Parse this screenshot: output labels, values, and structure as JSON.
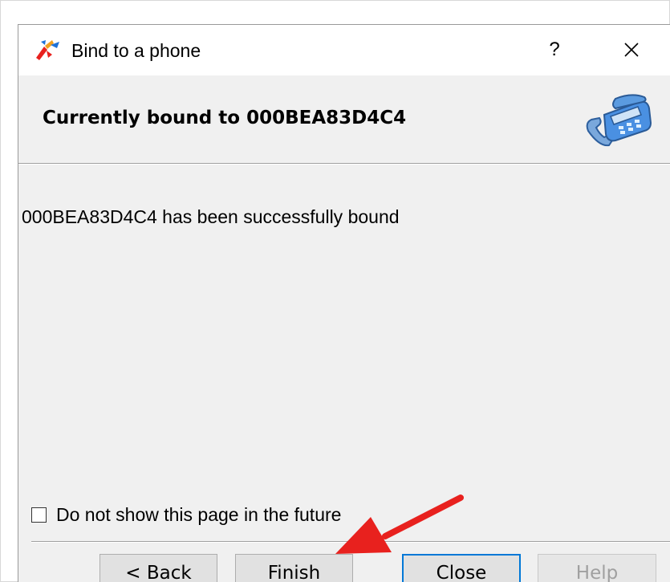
{
  "window": {
    "title": "Bind to a phone",
    "help_label": "?",
    "close_icon": "close-icon"
  },
  "header": {
    "title": "Currently bound to 000BEA83D4C4",
    "icon": "telephone-icon"
  },
  "body": {
    "message": "000BEA83D4C4 has been successfully bound"
  },
  "options": {
    "dont_show_label": "Do not show this page in the future",
    "dont_show_checked": false
  },
  "buttons": {
    "back": "< Back",
    "finish": "Finish",
    "close": "Close",
    "help": "Help"
  },
  "annotation": {
    "arrow_color": "#e8211e"
  },
  "colors": {
    "accent": "#0078d7",
    "dialog_bg": "#f0f0f0"
  }
}
